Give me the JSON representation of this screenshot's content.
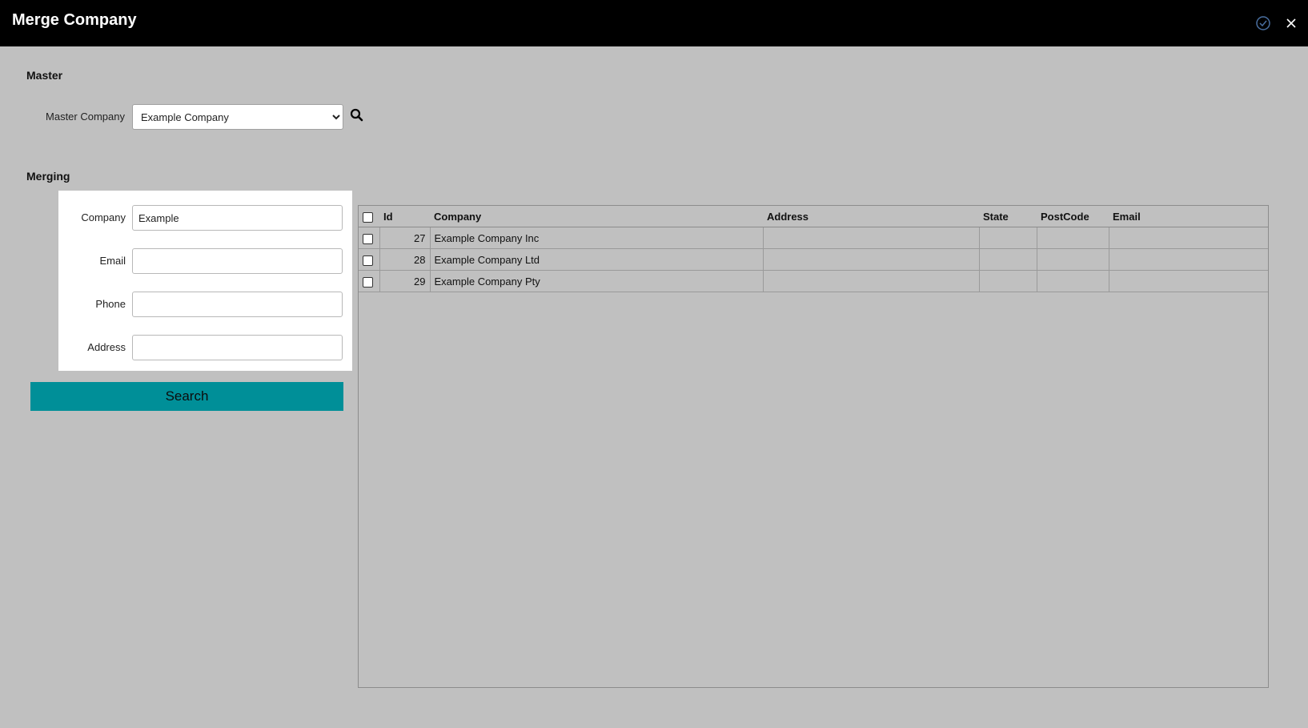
{
  "window": {
    "title": "Merge Company"
  },
  "master": {
    "heading": "Master",
    "company_label": "Master Company",
    "company_value": "Example Company"
  },
  "merging": {
    "heading": "Merging",
    "fields": {
      "company_label": "Company",
      "company_value": "Example",
      "email_label": "Email",
      "email_value": "",
      "phone_label": "Phone",
      "phone_value": "",
      "address_label": "Address",
      "address_value": ""
    },
    "search_label": "Search"
  },
  "results": {
    "columns": {
      "id": "Id",
      "company": "Company",
      "address": "Address",
      "state": "State",
      "postcode": "PostCode",
      "email": "Email"
    },
    "rows": [
      {
        "id": "27",
        "company": "Example Company Inc",
        "address": "",
        "state": "",
        "postcode": "",
        "email": ""
      },
      {
        "id": "28",
        "company": "Example Company Ltd",
        "address": "",
        "state": "",
        "postcode": "",
        "email": ""
      },
      {
        "id": "29",
        "company": "Example Company Pty",
        "address": "",
        "state": "",
        "postcode": "",
        "email": ""
      }
    ]
  },
  "colors": {
    "titlebar": "#000000",
    "background": "#c0c0c0",
    "accent": "#008f98"
  }
}
